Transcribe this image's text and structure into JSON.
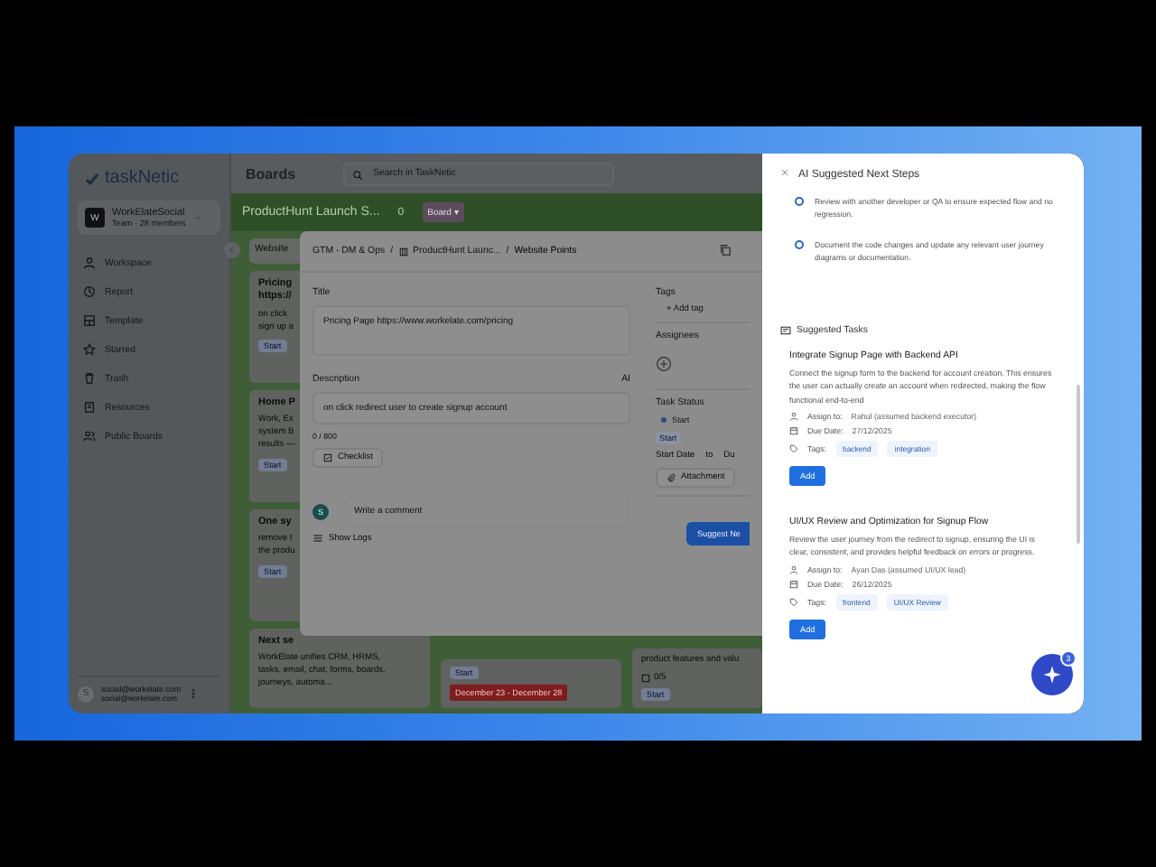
{
  "sidebar": {
    "logo": "taskNetic",
    "workspace": {
      "initial": "W",
      "name": "WorkElateSocial",
      "subtitle": "Team · 28 members"
    },
    "items": [
      {
        "label": "Workspace"
      },
      {
        "label": "Report"
      },
      {
        "label": "Template"
      },
      {
        "label": "Starred"
      },
      {
        "label": "Trash"
      },
      {
        "label": "Resources"
      },
      {
        "label": "Public Boards"
      }
    ],
    "user": {
      "initial": "S",
      "email": "social@workelate.com",
      "secondary": "social@workelate.com"
    }
  },
  "topbar": {
    "title": "Boards",
    "search": {
      "placeholder": "Search in TaskNetic"
    }
  },
  "board": {
    "name": "ProductHunt Launch S...",
    "count": "0",
    "view": "Board ▾",
    "columns": [
      {
        "title": "Website",
        "cards": [
          {
            "title": "Pricing\nhttps://",
            "body": "on click\nsign up a",
            "tag": "Start"
          },
          {
            "title": "Home P",
            "body": "Work, Ex\nsystem B\nresults —",
            "tag": "Start"
          },
          {
            "title": "One sy",
            "body": "remove t\nthe produ",
            "tag": "Start"
          },
          {
            "title": "Next se",
            "body": "WorkElate unifies CRM, HRMS,\ntasks, email, chat, forms, boards,\njourneys, automa..."
          }
        ]
      },
      {
        "cards": [
          {
            "tag": "Start",
            "date": "December 23 - December 28"
          }
        ]
      },
      {
        "cards": [
          {
            "body": "product features and valu",
            "checklist": "0/5",
            "tag": "Start"
          }
        ]
      }
    ]
  },
  "modal": {
    "breadcrumb_separator": "/",
    "breadcrumb": [
      "GTM - DM & Ops",
      "ProductHunt Launc...",
      "Website Points"
    ],
    "title_label": "Title",
    "title_value": "Pricing Page https://www.workelate.com/pricing",
    "description_label": "Description",
    "ai_label": "AI",
    "description_value": "on click redirect user to create signup account",
    "counter": "0 / 800",
    "checklist_button": "Checklist",
    "comment": {
      "initial": "S",
      "placeholder": "Write a comment"
    },
    "logs_button": "Show Logs",
    "tags_label": "Tags",
    "add_tag": "+ Add tag",
    "assignees_label": "Assignees",
    "status_label": "Task Status",
    "status": "Start",
    "status_chip": "Start",
    "start_date": "Start Date",
    "to": "to",
    "due_date": "Du",
    "attachment_button": "Attachment",
    "suggest_button": "Suggest Ne"
  },
  "panel": {
    "title": "AI Suggested Next Steps",
    "steps": [
      "Review with another developer or QA to ensure expected flow and no regression.",
      "Document the code changes and update any relevant user journey diagrams or documentation."
    ],
    "tasks_heading": "Suggested Tasks",
    "tasks": [
      {
        "title": "Integrate Signup Page with Backend API",
        "description": "Connect the signup form to the backend for account creation. This ensures the user can actually create an account when redirected, making the flow functional end-to-end",
        "assign_label": "Assign to:",
        "assignee": "Rahul (assumed backend executor)",
        "due_label": "Due Date:",
        "due": "27/12/2025",
        "tags_label": "Tags:",
        "tags": [
          "backend",
          "integration"
        ],
        "button": "Add"
      },
      {
        "title": "UI/UX Review and Optimization for Signup Flow",
        "description": "Review the user journey from the redirect to signup, ensuring the UI is clear, consistent, and provides helpful feedback on errors or progress.",
        "assign_label": "Assign to:",
        "assignee": "Ayan Das (assumed UI/UX lead)",
        "due_label": "Due Date:",
        "due": "26/12/2025",
        "tags_label": "Tags:",
        "tags": [
          "frontend",
          "UI/UX Review"
        ],
        "button": "Add"
      }
    ],
    "fab_badge": "3"
  }
}
